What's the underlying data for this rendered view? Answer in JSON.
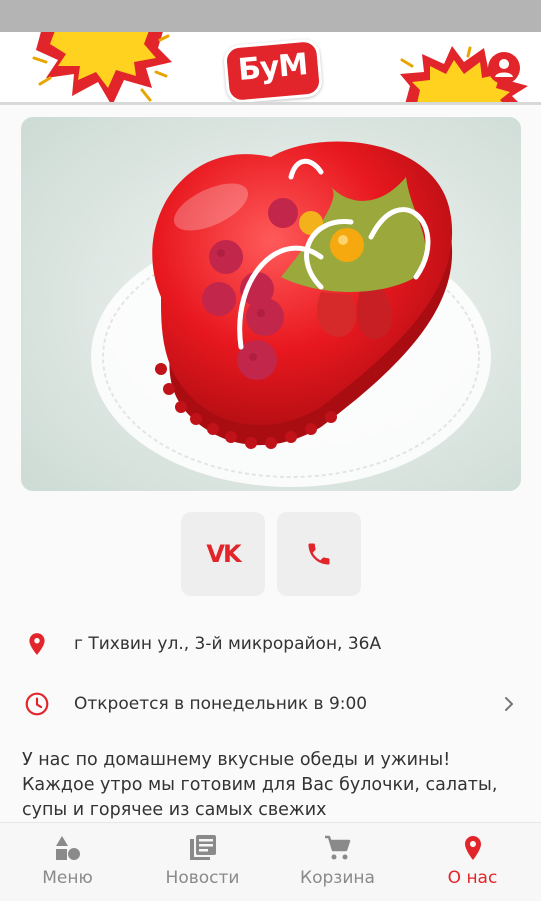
{
  "app": {
    "logo_text": "БуМ"
  },
  "hero": {
    "image": "heart-shaped-red-cake"
  },
  "social": {
    "vk_label": "VK",
    "phone_icon": "phone-icon"
  },
  "info": {
    "address": "г Тихвин ул., 3-й микрорайон, 36А",
    "hours": "Откроется в понедельник в 9:00"
  },
  "description": "У нас по домашнему вкусные обеды и ужины! Каждое утро мы готовим для Вас булочки, салаты, супы и горячее из самых свежих",
  "nav": {
    "items": [
      {
        "label": "Меню",
        "icon": "menu-shapes-icon",
        "active": false
      },
      {
        "label": "Новости",
        "icon": "news-icon",
        "active": false
      },
      {
        "label": "Корзина",
        "icon": "cart-icon",
        "active": false
      },
      {
        "label": "О нас",
        "icon": "location-pin-icon",
        "active": true
      }
    ]
  },
  "colors": {
    "accent": "#e1252b",
    "nav_inactive": "#8a8a8a",
    "burst_yellow": "#ffd21f"
  }
}
